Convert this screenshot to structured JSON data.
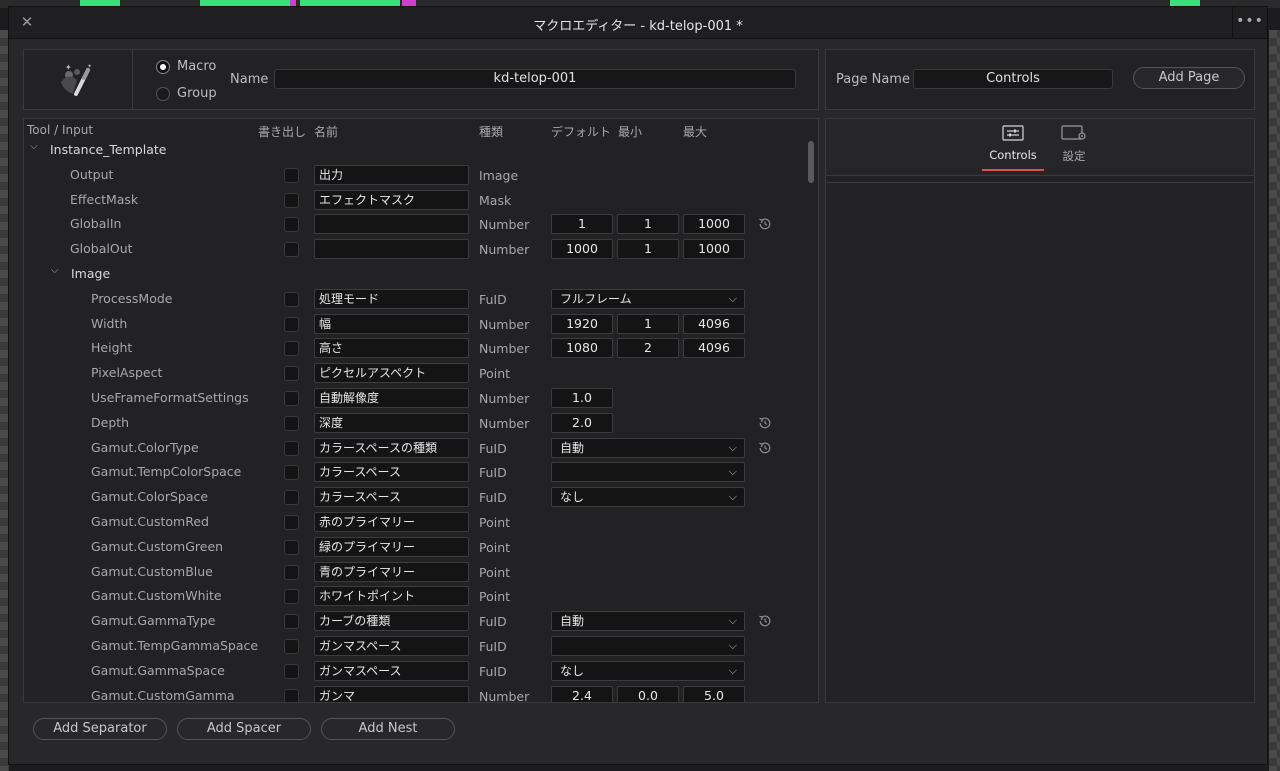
{
  "window": {
    "title": "マクロエディター - kd-telop-001 *",
    "menu_label": "•••"
  },
  "header": {
    "mode_macro": "Macro",
    "mode_group": "Group",
    "name_label": "Name",
    "name_value": "kd-telop-001",
    "page_name_label": "Page Name",
    "page_name_value": "Controls",
    "add_page": "Add Page"
  },
  "table": {
    "columns": {
      "tool_input": "Tool / Input",
      "export": "書き出し",
      "name": "名前",
      "type": "種類",
      "default": "デフォルト",
      "min": "最小",
      "max": "最大"
    },
    "rows": [
      {
        "label": "Instance_Template",
        "group": true,
        "level": 0
      },
      {
        "label": "Output",
        "level": 1,
        "name": "出力",
        "type": "Image"
      },
      {
        "label": "EffectMask",
        "level": 1,
        "name": "エフェクトマスク",
        "type": "Mask"
      },
      {
        "label": "GlobalIn",
        "level": 1,
        "name": "",
        "type": "Number",
        "default": "1",
        "min": "1",
        "max": "1000",
        "reset": true
      },
      {
        "label": "GlobalOut",
        "level": 1,
        "name": "",
        "type": "Number",
        "default": "1000",
        "min": "1",
        "max": "1000"
      },
      {
        "label": "Image",
        "group": true,
        "level": 1
      },
      {
        "label": "ProcessMode",
        "level": 2,
        "name": "処理モード",
        "type": "FuID",
        "select": "フルフレーム"
      },
      {
        "label": "Width",
        "level": 2,
        "name": "幅",
        "type": "Number",
        "default": "1920",
        "min": "1",
        "max": "4096"
      },
      {
        "label": "Height",
        "level": 2,
        "name": "高さ",
        "type": "Number",
        "default": "1080",
        "min": "2",
        "max": "4096"
      },
      {
        "label": "PixelAspect",
        "level": 2,
        "name": "ピクセルアスペクト",
        "type": "Point"
      },
      {
        "label": "UseFrameFormatSettings",
        "level": 2,
        "name": "自動解像度",
        "type": "Number",
        "default": "1.0"
      },
      {
        "label": "Depth",
        "level": 2,
        "name": "深度",
        "type": "Number",
        "default": "2.0",
        "reset": true
      },
      {
        "label": "Gamut.ColorType",
        "level": 2,
        "name": "カラースペースの種類",
        "type": "FuID",
        "select": "自動",
        "reset": true
      },
      {
        "label": "Gamut.TempColorSpace",
        "level": 2,
        "name": "カラースペース",
        "type": "FuID",
        "select": ""
      },
      {
        "label": "Gamut.ColorSpace",
        "level": 2,
        "name": "カラースペース",
        "type": "FuID",
        "select": "なし"
      },
      {
        "label": "Gamut.CustomRed",
        "level": 2,
        "name": "赤のプライマリー",
        "type": "Point"
      },
      {
        "label": "Gamut.CustomGreen",
        "level": 2,
        "name": "緑のプライマリー",
        "type": "Point"
      },
      {
        "label": "Gamut.CustomBlue",
        "level": 2,
        "name": "青のプライマリー",
        "type": "Point"
      },
      {
        "label": "Gamut.CustomWhite",
        "level": 2,
        "name": "ホワイトポイント",
        "type": "Point"
      },
      {
        "label": "Gamut.GammaType",
        "level": 2,
        "name": "カーブの種類",
        "type": "FuID",
        "select": "自動",
        "reset": true
      },
      {
        "label": "Gamut.TempGammaSpace",
        "level": 2,
        "name": "ガンマスペース",
        "type": "FuID",
        "select": ""
      },
      {
        "label": "Gamut.GammaSpace",
        "level": 2,
        "name": "ガンマスペース",
        "type": "FuID",
        "select": "なし"
      },
      {
        "label": "Gamut.CustomGamma",
        "level": 2,
        "name": "ガンマ",
        "type": "Number",
        "default": "2.4",
        "min": "0.0",
        "max": "5.0"
      }
    ]
  },
  "right_panel": {
    "tabs": [
      {
        "label": "Controls",
        "active": true,
        "icon": "sliders-icon"
      },
      {
        "label": "設定",
        "active": false,
        "icon": "settings-panel-icon"
      }
    ]
  },
  "footer": {
    "add_separator": "Add Separator",
    "add_spacer": "Add Spacer",
    "add_nest": "Add Nest"
  },
  "colors": {
    "accent": "#e05050",
    "window_bg": "#28282b",
    "input_bg": "#141415"
  }
}
